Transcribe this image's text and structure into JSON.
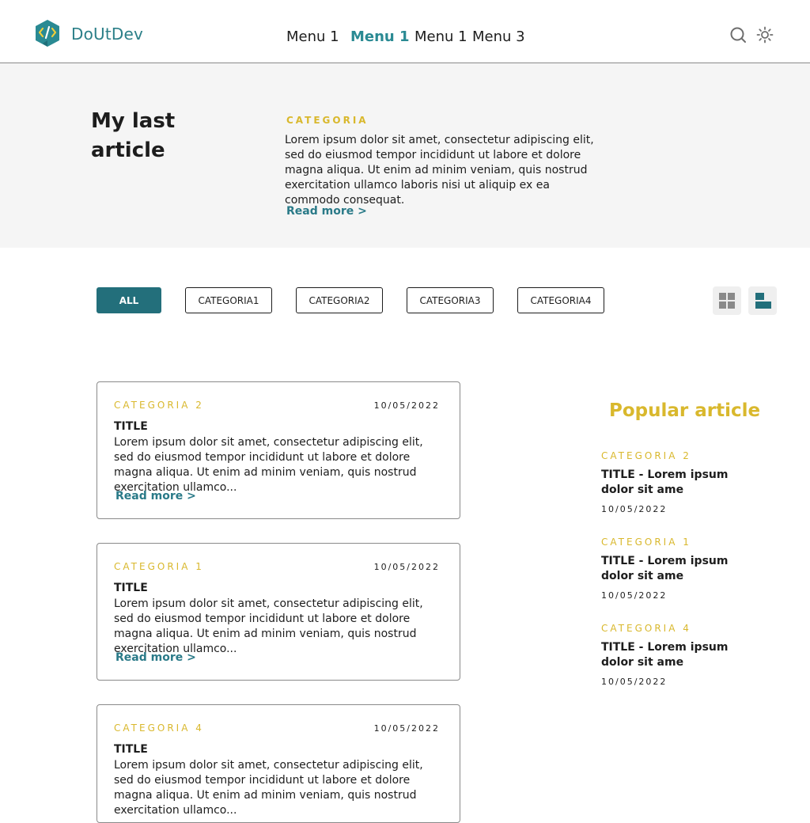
{
  "brand": {
    "name": "DoUtDev"
  },
  "nav": [
    {
      "label": "Menu 1",
      "active": false
    },
    {
      "label": "Menu 1",
      "active": true
    },
    {
      "label": "Menu 1",
      "active": false
    },
    {
      "label": "Menu 3",
      "active": false
    }
  ],
  "header_icons": {
    "search": "search-icon",
    "theme": "sun-icon"
  },
  "hero": {
    "title": "My last article",
    "category": "CATEGORIA",
    "text": "Lorem ipsum dolor sit amet, consectetur adipiscing elit, sed do eiusmod tempor incididunt ut labore et dolore magna aliqua. Ut enim ad minim veniam, quis nostrud exercitation ullamco laboris nisi ut aliquip ex ea commodo consequat.",
    "read_more": "Read more >"
  },
  "filters": [
    {
      "label": "ALL",
      "active": true
    },
    {
      "label": "CATEGORIA1",
      "active": false
    },
    {
      "label": "CATEGORIA2",
      "active": false
    },
    {
      "label": "CATEGORIA3",
      "active": false
    },
    {
      "label": "CATEGORIA4",
      "active": false
    }
  ],
  "view_toggle": {
    "grid": "grid-view-icon",
    "list": "list-view-icon",
    "selected": "list"
  },
  "articles": [
    {
      "category": "CATEGORIA 2",
      "date": "10/05/2022",
      "title": "TITLE",
      "text": "Lorem ipsum dolor sit amet, consectetur adipiscing elit, sed do eiusmod tempor incididunt ut labore et dolore magna aliqua. Ut enim ad minim veniam, quis nostrud exercitation ullamco...",
      "read_more": "Read more >"
    },
    {
      "category": "CATEGORIA 1",
      "date": "10/05/2022",
      "title": "TITLE",
      "text": "Lorem ipsum dolor sit amet, consectetur adipiscing elit, sed do eiusmod tempor incididunt ut labore et dolore magna aliqua. Ut enim ad minim veniam, quis nostrud exercitation ullamco...",
      "read_more": "Read more >"
    },
    {
      "category": "CATEGORIA 4",
      "date": "10/05/2022",
      "title": "TITLE",
      "text": "Lorem ipsum dolor sit amet, consectetur adipiscing elit, sed do eiusmod tempor incididunt ut labore et dolore magna aliqua. Ut enim ad minim veniam, quis nostrud exercitation ullamco...",
      "read_more": ""
    }
  ],
  "popular": {
    "heading": "Popular article",
    "items": [
      {
        "category": "CATEGORIA 2",
        "title": "TITLE - Lorem ipsum dolor sit ame",
        "date": "10/05/2022"
      },
      {
        "category": "CATEGORIA 1",
        "title": "TITLE - Lorem ipsum dolor sit ame",
        "date": "10/05/2022"
      },
      {
        "category": "CATEGORIA 4",
        "title": "TITLE - Lorem ipsum dolor sit ame",
        "date": "10/05/2022"
      }
    ]
  },
  "colors": {
    "accent": "#2a8a93",
    "accent_dark": "#236f7b",
    "category": "#d9b82d",
    "hero_bg": "#f5f5f5"
  }
}
